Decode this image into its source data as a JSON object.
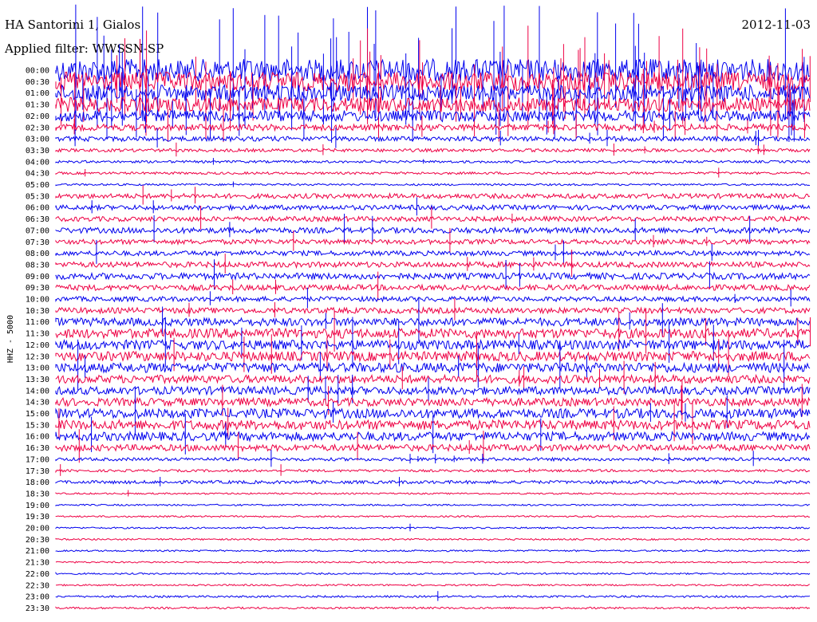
{
  "header": {
    "station": "HA Santorini 1, Gialos",
    "date": "2012-11-03",
    "filter": "Applied filter: WWSSN-SP"
  },
  "chart_data": {
    "type": "line",
    "title": "HA Santorini 1, Gialos",
    "subtitle": "Applied filter: WWSSN-SP",
    "date": "2012-11-03",
    "ylabel": "HHZ - 5000",
    "colors": [
      "#0000ee",
      "#ee0044"
    ],
    "tracks": [
      {
        "label": "00:00",
        "amplitude": 14,
        "spikes": 30
      },
      {
        "label": "00:30",
        "amplitude": 12,
        "spikes": 30
      },
      {
        "label": "01:00",
        "amplitude": 10,
        "spikes": 28
      },
      {
        "label": "01:30",
        "amplitude": 9,
        "spikes": 26
      },
      {
        "label": "02:00",
        "amplitude": 7,
        "spikes": 22
      },
      {
        "label": "02:30",
        "amplitude": 4,
        "spikes": 12
      },
      {
        "label": "03:00",
        "amplitude": 3,
        "spikes": 8
      },
      {
        "label": "03:30",
        "amplitude": 2,
        "spikes": 6
      },
      {
        "label": "04:00",
        "amplitude": 1.5,
        "spikes": 2
      },
      {
        "label": "04:30",
        "amplitude": 1.5,
        "spikes": 2
      },
      {
        "label": "05:00",
        "amplitude": 1.2,
        "spikes": 1
      },
      {
        "label": "05:30",
        "amplitude": 3,
        "spikes": 3
      },
      {
        "label": "06:00",
        "amplitude": 3,
        "spikes": 3
      },
      {
        "label": "06:30",
        "amplitude": 3,
        "spikes": 3
      },
      {
        "label": "07:00",
        "amplitude": 3.5,
        "spikes": 6
      },
      {
        "label": "07:30",
        "amplitude": 3,
        "spikes": 4
      },
      {
        "label": "08:00",
        "amplitude": 3,
        "spikes": 4
      },
      {
        "label": "08:30",
        "amplitude": 3.5,
        "spikes": 4
      },
      {
        "label": "09:00",
        "amplitude": 4,
        "spikes": 4
      },
      {
        "label": "09:30",
        "amplitude": 3.5,
        "spikes": 3
      },
      {
        "label": "10:00",
        "amplitude": 3,
        "spikes": 4
      },
      {
        "label": "10:30",
        "amplitude": 3.5,
        "spikes": 3
      },
      {
        "label": "11:00",
        "amplitude": 5,
        "spikes": 5
      },
      {
        "label": "11:30",
        "amplitude": 6,
        "spikes": 6
      },
      {
        "label": "12:00",
        "amplitude": 6,
        "spikes": 8
      },
      {
        "label": "12:30",
        "amplitude": 6,
        "spikes": 8
      },
      {
        "label": "13:00",
        "amplitude": 6,
        "spikes": 8
      },
      {
        "label": "13:30",
        "amplitude": 5,
        "spikes": 6
      },
      {
        "label": "14:00",
        "amplitude": 5,
        "spikes": 5
      },
      {
        "label": "14:30",
        "amplitude": 5,
        "spikes": 5
      },
      {
        "label": "15:00",
        "amplitude": 6,
        "spikes": 5
      },
      {
        "label": "15:30",
        "amplitude": 6,
        "spikes": 5
      },
      {
        "label": "16:00",
        "amplitude": 5.5,
        "spikes": 5
      },
      {
        "label": "16:30",
        "amplitude": 4,
        "spikes": 5
      },
      {
        "label": "17:00",
        "amplitude": 2,
        "spikes": 8
      },
      {
        "label": "17:30",
        "amplitude": 1.5,
        "spikes": 3
      },
      {
        "label": "18:00",
        "amplitude": 2,
        "spikes": 2
      },
      {
        "label": "18:30",
        "amplitude": 1,
        "spikes": 1
      },
      {
        "label": "19:00",
        "amplitude": 1,
        "spikes": 0
      },
      {
        "label": "19:30",
        "amplitude": 1,
        "spikes": 0
      },
      {
        "label": "20:00",
        "amplitude": 1,
        "spikes": 1
      },
      {
        "label": "20:30",
        "amplitude": 1,
        "spikes": 0
      },
      {
        "label": "21:00",
        "amplitude": 1,
        "spikes": 0
      },
      {
        "label": "21:30",
        "amplitude": 1,
        "spikes": 0
      },
      {
        "label": "22:00",
        "amplitude": 1,
        "spikes": 0
      },
      {
        "label": "22:30",
        "amplitude": 1,
        "spikes": 0
      },
      {
        "label": "23:00",
        "amplitude": 1.2,
        "spikes": 1
      },
      {
        "label": "23:30",
        "amplitude": 1.2,
        "spikes": 0
      }
    ]
  }
}
